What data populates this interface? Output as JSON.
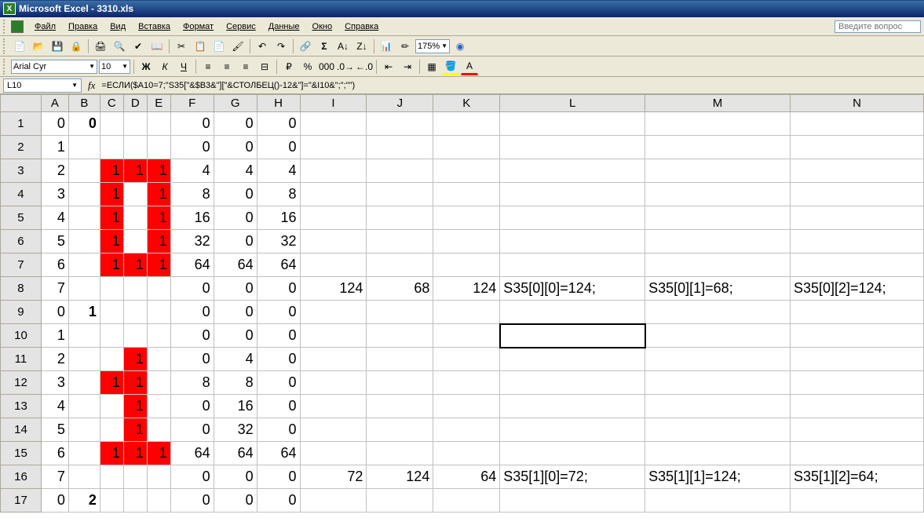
{
  "window": {
    "title": "Microsoft Excel - 3310.xls"
  },
  "menubar": {
    "items": [
      "Файл",
      "Правка",
      "Вид",
      "Вставка",
      "Формат",
      "Сервис",
      "Данные",
      "Окно",
      "Справка"
    ],
    "search_placeholder": "Введите вопрос"
  },
  "toolbar1": {
    "zoom": "175%"
  },
  "toolbar2": {
    "font": "Arial Cyr",
    "size": "10"
  },
  "formulabar": {
    "name_box": "L10",
    "fx": "fx",
    "formula": "=ЕСЛИ($A10=7;\"S35[\"&$B3&\"][\"&СТОЛБЕЦ()-12&\"]=\"&I10&\";\";\"\")"
  },
  "columns": [
    "A",
    "B",
    "C",
    "D",
    "E",
    "F",
    "G",
    "H",
    "I",
    "J",
    "K",
    "L",
    "M",
    "N"
  ],
  "selected": {
    "cell": "L10",
    "col": "L",
    "row": 10
  },
  "rows": [
    {
      "r": 1,
      "A": "0",
      "B": "0",
      "Bb": true,
      "F": "0",
      "G": "0",
      "H": "0"
    },
    {
      "r": 2,
      "A": "1",
      "F": "0",
      "G": "0",
      "H": "0"
    },
    {
      "r": 3,
      "A": "2",
      "C": "1",
      "D": "1",
      "E": "1",
      "red": [
        "C",
        "D",
        "E"
      ],
      "F": "4",
      "G": "4",
      "H": "4"
    },
    {
      "r": 4,
      "A": "3",
      "C": "1",
      "E": "1",
      "red": [
        "C",
        "E"
      ],
      "F": "8",
      "G": "0",
      "H": "8"
    },
    {
      "r": 5,
      "A": "4",
      "C": "1",
      "E": "1",
      "red": [
        "C",
        "E"
      ],
      "F": "16",
      "G": "0",
      "H": "16"
    },
    {
      "r": 6,
      "A": "5",
      "C": "1",
      "E": "1",
      "red": [
        "C",
        "E"
      ],
      "F": "32",
      "G": "0",
      "H": "32"
    },
    {
      "r": 7,
      "A": "6",
      "C": "1",
      "D": "1",
      "E": "1",
      "red": [
        "C",
        "D",
        "E"
      ],
      "F": "64",
      "G": "64",
      "H": "64"
    },
    {
      "r": 8,
      "A": "7",
      "F": "0",
      "G": "0",
      "H": "0",
      "I": "124",
      "J": "68",
      "K": "124",
      "L": "S35[0][0]=124;",
      "M": "S35[0][1]=68;",
      "N": "S35[0][2]=124;"
    },
    {
      "r": 9,
      "A": "0",
      "B": "1",
      "Bb": true,
      "F": "0",
      "G": "0",
      "H": "0"
    },
    {
      "r": 10,
      "A": "1",
      "F": "0",
      "G": "0",
      "H": "0",
      "L": ""
    },
    {
      "r": 11,
      "A": "2",
      "D": "1",
      "red": [
        "D"
      ],
      "F": "0",
      "G": "4",
      "H": "0"
    },
    {
      "r": 12,
      "A": "3",
      "C": "1",
      "D": "1",
      "red": [
        "C",
        "D"
      ],
      "F": "8",
      "G": "8",
      "H": "0"
    },
    {
      "r": 13,
      "A": "4",
      "D": "1",
      "red": [
        "D"
      ],
      "F": "0",
      "G": "16",
      "H": "0"
    },
    {
      "r": 14,
      "A": "5",
      "D": "1",
      "red": [
        "D"
      ],
      "F": "0",
      "G": "32",
      "H": "0"
    },
    {
      "r": 15,
      "A": "6",
      "C": "1",
      "D": "1",
      "E": "1",
      "red": [
        "C",
        "D",
        "E"
      ],
      "F": "64",
      "G": "64",
      "H": "64"
    },
    {
      "r": 16,
      "A": "7",
      "F": "0",
      "G": "0",
      "H": "0",
      "I": "72",
      "J": "124",
      "K": "64",
      "L": "S35[1][0]=72;",
      "M": "S35[1][1]=124;",
      "N": "S35[1][2]=64;"
    },
    {
      "r": 17,
      "A": "0",
      "B": "2",
      "Bb": true,
      "F": "0",
      "G": "0",
      "H": "0"
    }
  ]
}
